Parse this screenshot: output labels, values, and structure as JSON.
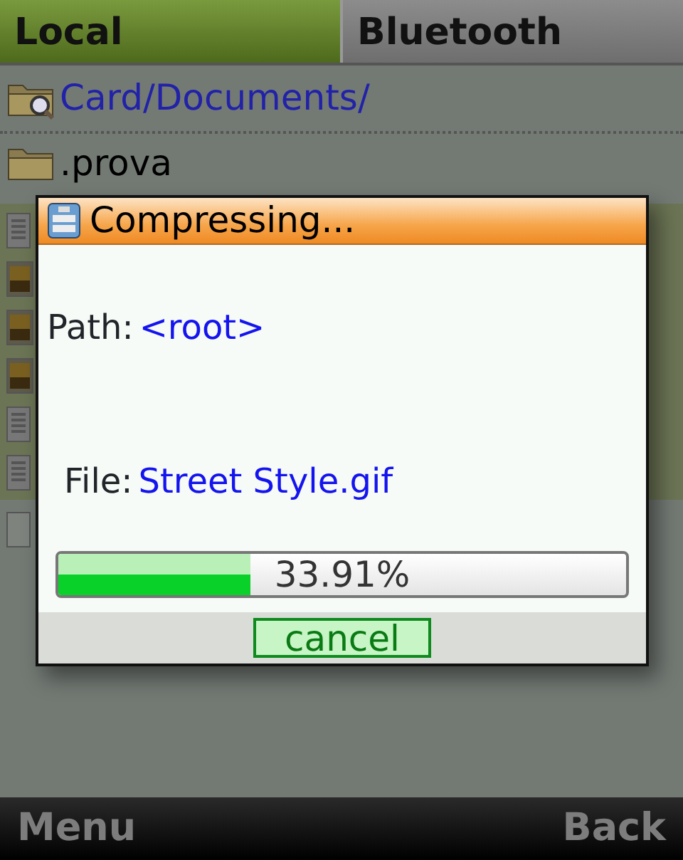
{
  "tabs": [
    {
      "label": "Local",
      "selected": true
    },
    {
      "label": "Bluetooth",
      "selected": false
    }
  ],
  "path": "Card/Documents/",
  "items": [
    {
      "name": ".prova",
      "kind": "folder"
    }
  ],
  "dialog": {
    "title": "Compressing...",
    "path_label": "Path:",
    "path_value": "<root>",
    "file_label": "File:",
    "file_value": "Street Style.gif",
    "progress": {
      "level": 0.3391,
      "reading": "33.91%"
    },
    "button": "cancel"
  },
  "softkeys": {
    "left": "Menu",
    "right": "Back"
  }
}
